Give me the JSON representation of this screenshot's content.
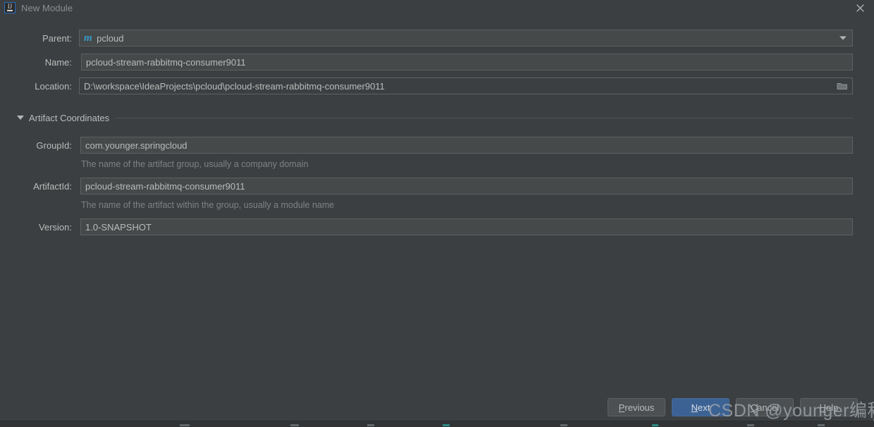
{
  "window": {
    "title": "New Module",
    "app_icon": "intellij-idea-icon",
    "close_icon": "close-icon",
    "background_color": "#3c3f41",
    "accent_color": "#3c6294"
  },
  "form": {
    "fields": [
      {
        "id": "parent",
        "label": "Parent:",
        "value": "pcloud",
        "icon": "maven-icon",
        "icon_glyph": "m",
        "control": "combobox",
        "control_icon": "chevron-down-icon"
      },
      {
        "id": "name",
        "label": "Name:",
        "value": "pcloud-stream-rabbitmq-consumer9011",
        "control": "textfield"
      },
      {
        "id": "location",
        "label": "Location:",
        "value": "D:\\workspace\\IdeaProjects\\pcloud\\pcloud-stream-rabbitmq-consumer9011",
        "control": "textfield-with-browse",
        "control_icon": "folder-icon"
      }
    ]
  },
  "artifact_section": {
    "title": "Artifact Coordinates",
    "expanded": true,
    "toggle_icon": "triangle-down-icon",
    "fields": [
      {
        "id": "groupid",
        "label": "GroupId:",
        "value": "com.younger.springcloud",
        "hint": "The name of the artifact group, usually a company domain"
      },
      {
        "id": "artifactid",
        "label": "ArtifactId:",
        "value": "pcloud-stream-rabbitmq-consumer9011",
        "hint": "The name of the artifact within the group, usually a module name"
      },
      {
        "id": "version",
        "label": "Version:",
        "value": "1.0-SNAPSHOT",
        "hint": ""
      }
    ]
  },
  "buttons": {
    "previous": {
      "prefix": "",
      "mnemonic": "P",
      "suffix": "revious"
    },
    "next": {
      "prefix": "",
      "mnemonic": "N",
      "suffix": "ext"
    },
    "cancel": {
      "prefix": "",
      "mnemonic": "C",
      "suffix": "ancel"
    },
    "help": {
      "prefix": "",
      "mnemonic": "H",
      "suffix": "elp"
    }
  },
  "watermark": {
    "text": "CSDN @younger编程世界",
    "tail": ")"
  }
}
